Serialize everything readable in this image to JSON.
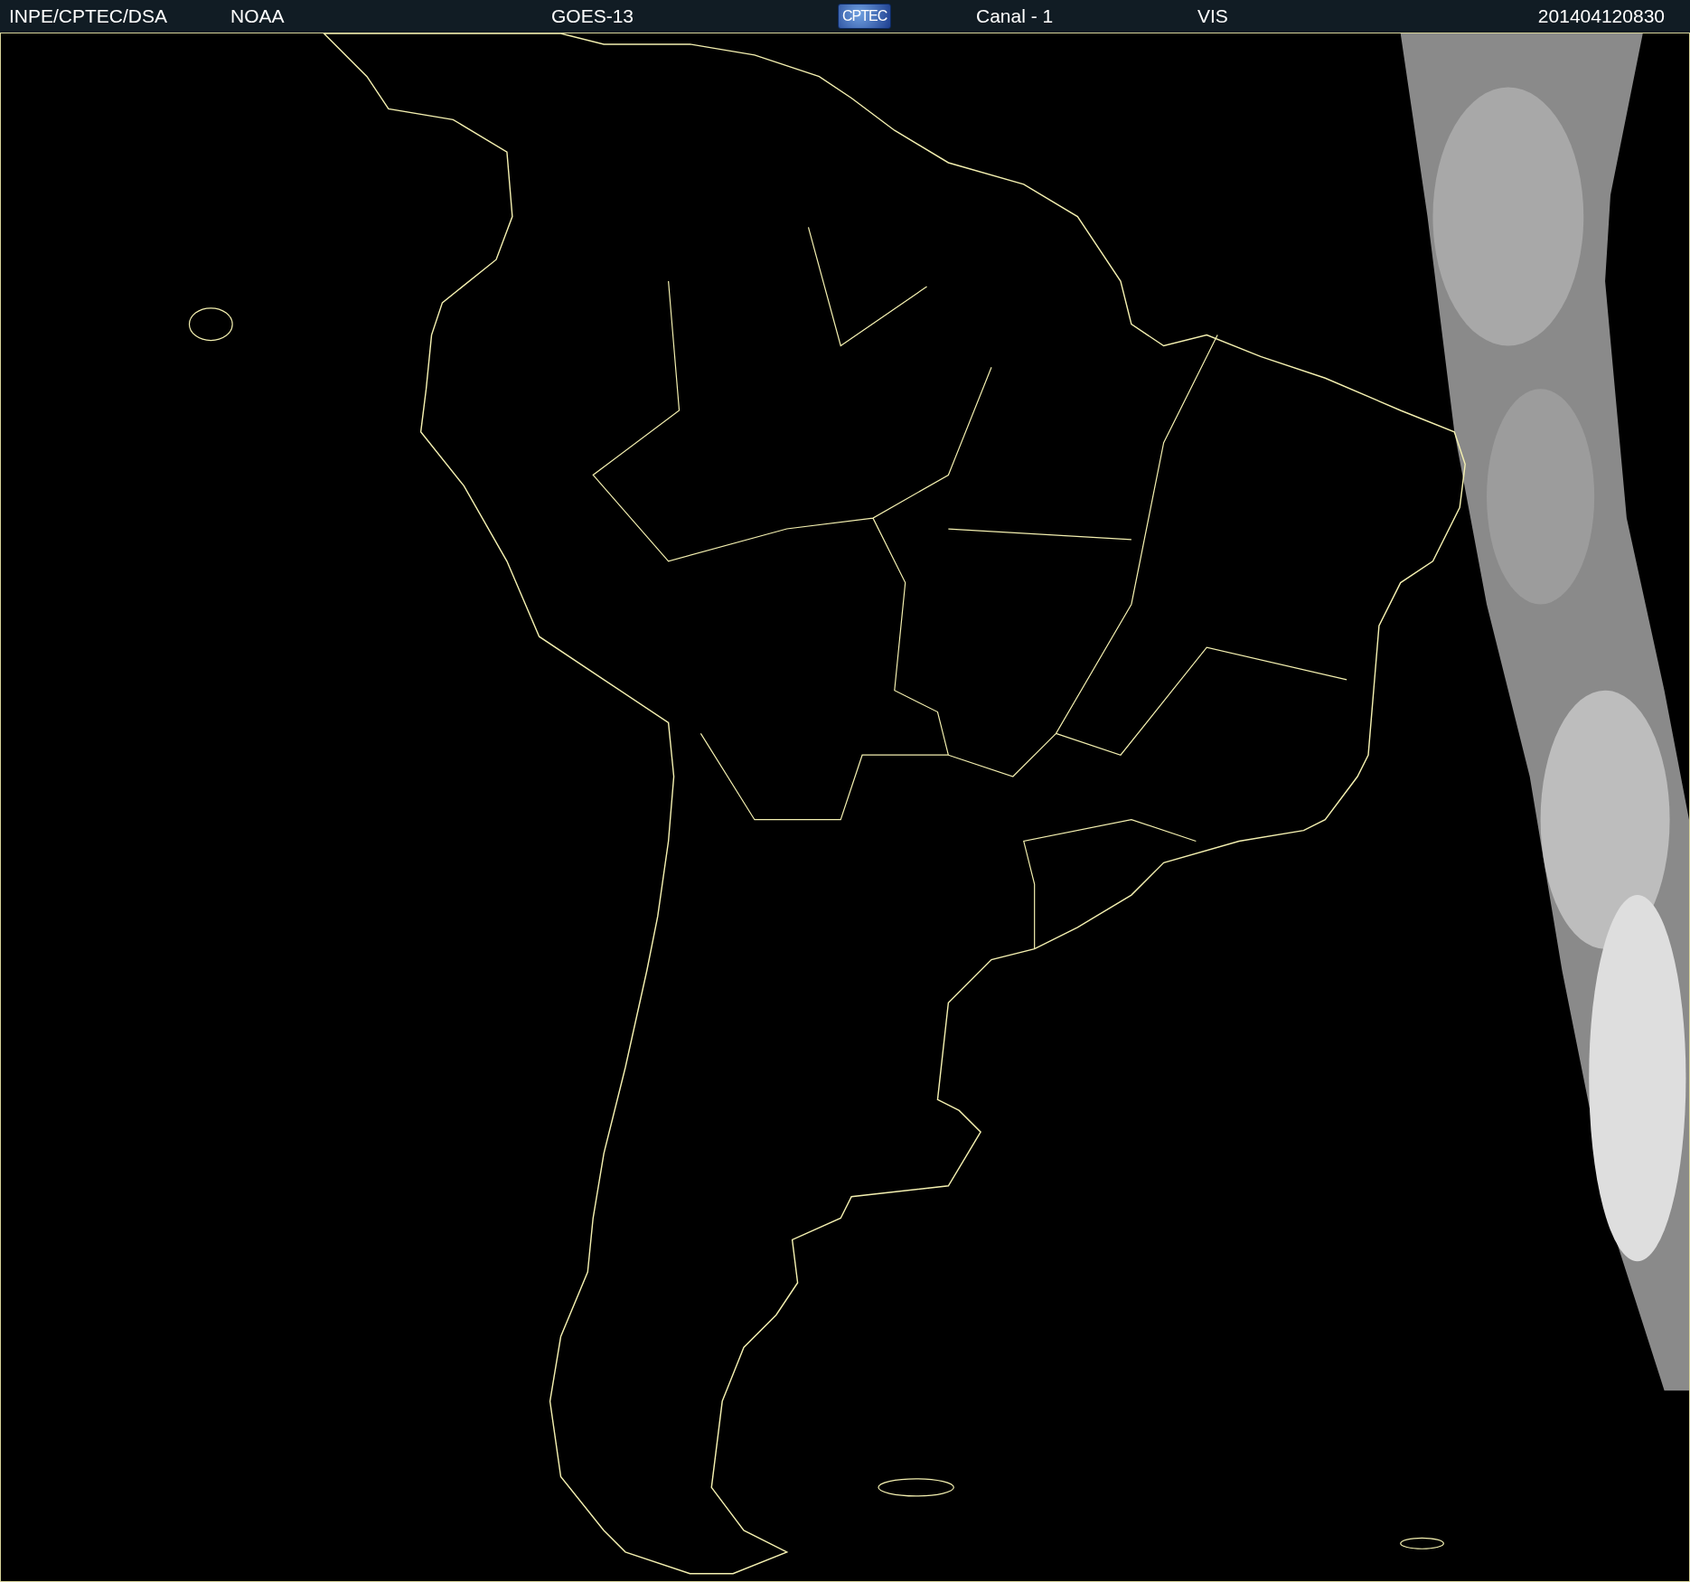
{
  "header": {
    "source": "INPE/CPTEC/DSA",
    "agency": "NOAA",
    "satellite": "GOES-13",
    "logo": "CPTEC",
    "channel": "Canal - 1",
    "band": "VIS",
    "timestamp": "201404120830"
  }
}
